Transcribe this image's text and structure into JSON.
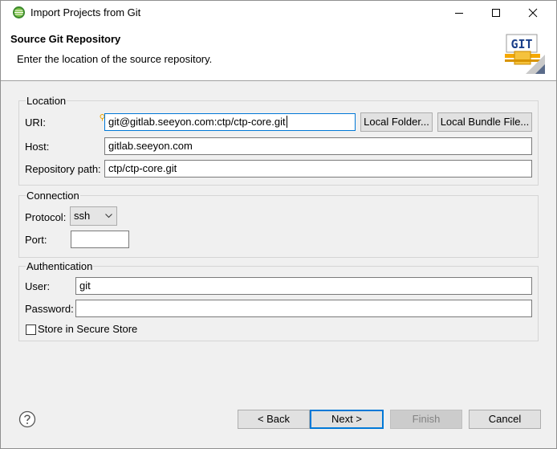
{
  "window": {
    "title": "Import Projects from Git",
    "controls": [
      "minimize",
      "maximize",
      "close"
    ]
  },
  "header": {
    "title": "Source Git Repository",
    "description": "Enter the location of the source repository.",
    "logo_text": "GIT"
  },
  "location": {
    "group_title": "Location",
    "uri_label": "URI:",
    "uri_value": "git@gitlab.seeyon.com:ctp/ctp-core.git",
    "local_folder_button": "Local Folder...",
    "local_bundle_button": "Local Bundle File...",
    "host_label": "Host:",
    "host_value": "gitlab.seeyon.com",
    "repo_path_label": "Repository path:",
    "repo_path_value": "ctp/ctp-core.git"
  },
  "connection": {
    "group_title": "Connection",
    "protocol_label": "Protocol:",
    "protocol_value": "ssh",
    "port_label": "Port:",
    "port_value": ""
  },
  "authentication": {
    "group_title": "Authentication",
    "user_label": "User:",
    "user_value": "git",
    "password_label": "Password:",
    "password_value": "",
    "store_label": "Store in Secure Store",
    "store_checked": false
  },
  "footer": {
    "back_label": "< Back",
    "next_label": "Next >",
    "finish_label": "Finish",
    "cancel_label": "Cancel"
  },
  "colors": {
    "focus_border": "#0078d7",
    "dialog_bg": "#f0f0f0",
    "git_logo_accent": "#f5a800"
  },
  "icons": {
    "app": "eclipse-icon",
    "help": "help-icon",
    "hint": "lightbulb-icon"
  }
}
